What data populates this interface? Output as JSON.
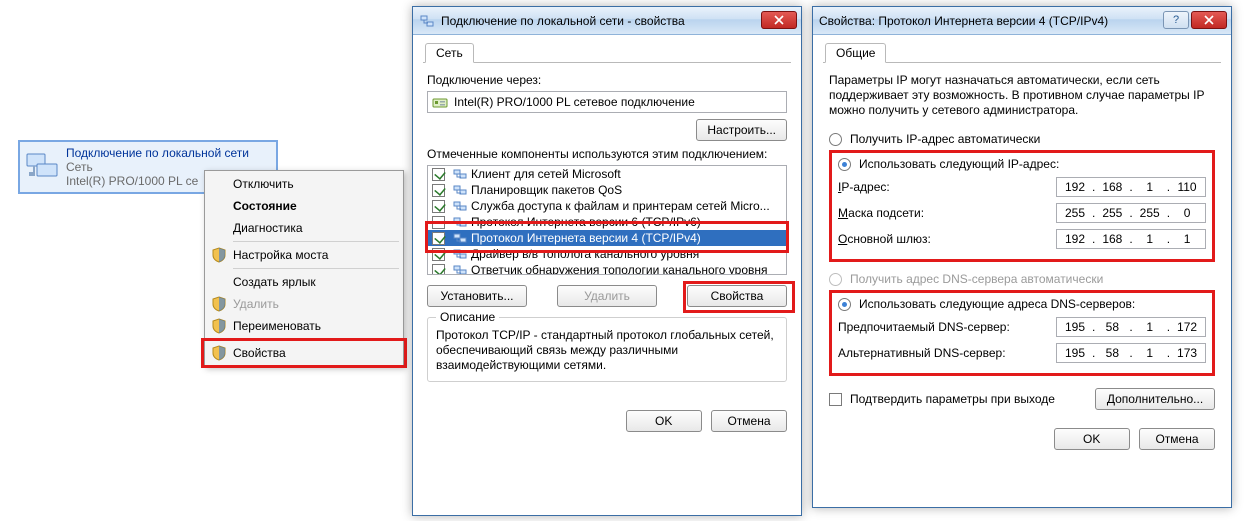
{
  "lan_item": {
    "title": "Подключение по локальной сети",
    "line2": "Сеть",
    "line3": "Intel(R) PRO/1000 PL се"
  },
  "context_menu": {
    "items": [
      "Отключить",
      "Состояние",
      "Диагностика",
      "Настройка моста",
      "Создать ярлык",
      "Удалить",
      "Переименовать",
      "Свойства"
    ]
  },
  "conn_window": {
    "title": "Подключение по локальной сети - свойства",
    "tab": "Сеть",
    "connect_via_label": "Подключение через:",
    "adapter_name": "Intel(R) PRO/1000 PL сетевое подключение",
    "configure_btn": "Настроить...",
    "components_label": "Отмеченные компоненты используются этим подключением:",
    "components": [
      {
        "checked": true,
        "label": "Клиент для сетей Microsoft"
      },
      {
        "checked": true,
        "label": "Планировщик пакетов QoS"
      },
      {
        "checked": true,
        "label": "Служба доступа к файлам и принтерам сетей Micro..."
      },
      {
        "checked": false,
        "label": "Протокол Интернета версии 6 (TCP/IPv6)"
      },
      {
        "checked": true,
        "label": "Протокол Интернета версии 4 (TCP/IPv4)",
        "selected": true
      },
      {
        "checked": true,
        "label": "Драйвер в/в тополога канального уровня"
      },
      {
        "checked": true,
        "label": "Ответчик обнаружения топологии канального уровня"
      }
    ],
    "install_btn": "Установить...",
    "remove_btn": "Удалить",
    "properties_btn": "Свойства",
    "desc_header": "Описание",
    "desc_text": "Протокол TCP/IP - стандартный протокол глобальных сетей, обеспечивающий связь между различными взаимодействующими сетями.",
    "ok_btn": "OK",
    "cancel_btn": "Отмена"
  },
  "ip_window": {
    "title": "Свойства: Протокол Интернета версии 4 (TCP/IPv4)",
    "tab": "Общие",
    "intro": "Параметры IP могут назначаться автоматически, если сеть поддерживает эту возможность. В противном случае параметры IP можно получить у сетевого администратора.",
    "radio_auto_ip": "Получить IP-адрес автоматически",
    "radio_manual_ip": "Использовать следующий IP-адрес:",
    "ip_label": "IP-адрес:",
    "ip_value": [
      "192",
      "168",
      "1",
      "110"
    ],
    "mask_label": "Маска подсети:",
    "mask_value": [
      "255",
      "255",
      "255",
      "0"
    ],
    "gw_label": "Основной шлюз:",
    "gw_value": [
      "192",
      "168",
      "1",
      "1"
    ],
    "radio_auto_dns": "Получить адрес DNS-сервера автоматически",
    "radio_manual_dns": "Использовать следующие адреса DNS-серверов:",
    "dns1_label": "Предпочитаемый DNS-сервер:",
    "dns1_value": [
      "195",
      "58",
      "1",
      "172"
    ],
    "dns2_label": "Альтернативный DNS-сервер:",
    "dns2_value": [
      "195",
      "58",
      "1",
      "173"
    ],
    "confirm_on_exit": "Подтвердить параметры при выходе",
    "advanced_btn": "Дополнительно...",
    "ok_btn": "OK",
    "cancel_btn": "Отмена"
  }
}
